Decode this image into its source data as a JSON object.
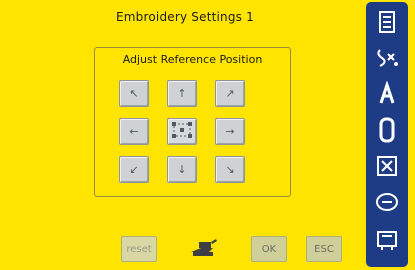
{
  "header": {
    "title": "Embroidery Settings 1"
  },
  "panel": {
    "title": "Adjust Reference Position",
    "buttons": [
      {
        "name": "arrow-up-left-button",
        "glyph": "↖"
      },
      {
        "name": "arrow-up-button",
        "glyph": "↑"
      },
      {
        "name": "arrow-up-right-button",
        "glyph": "↗"
      },
      {
        "name": "arrow-left-button",
        "glyph": "←"
      },
      {
        "name": "center-reference-button",
        "glyph": ""
      },
      {
        "name": "arrow-right-button",
        "glyph": "→"
      },
      {
        "name": "arrow-down-left-button",
        "glyph": "↙"
      },
      {
        "name": "arrow-down-button",
        "glyph": "↓"
      },
      {
        "name": "arrow-down-right-button",
        "glyph": "↘"
      }
    ]
  },
  "sidebar": {
    "items": [
      {
        "name": "sidebar-embroidery-menu-icon"
      },
      {
        "name": "sidebar-stitch-selection-icon"
      },
      {
        "name": "sidebar-alphabet-icon"
      },
      {
        "name": "sidebar-hoop-icon"
      },
      {
        "name": "sidebar-design-icon"
      },
      {
        "name": "sidebar-mode-icon"
      },
      {
        "name": "sidebar-setup-icon"
      }
    ]
  },
  "bottom_bar": {
    "buttons": [
      {
        "name": "reset-button",
        "label": "reset",
        "disabled": true
      },
      {
        "name": "thread-button",
        "label": "",
        "disabled": false
      },
      {
        "name": "ok-button",
        "label": "OK",
        "disabled": false
      },
      {
        "name": "esc-button",
        "label": "ESC",
        "disabled": false
      }
    ]
  },
  "colors": {
    "background": "#ffe400",
    "sidebar": "#1e3c86",
    "button": "#cfd2d3",
    "bottom_button": "#cfcf9a"
  }
}
